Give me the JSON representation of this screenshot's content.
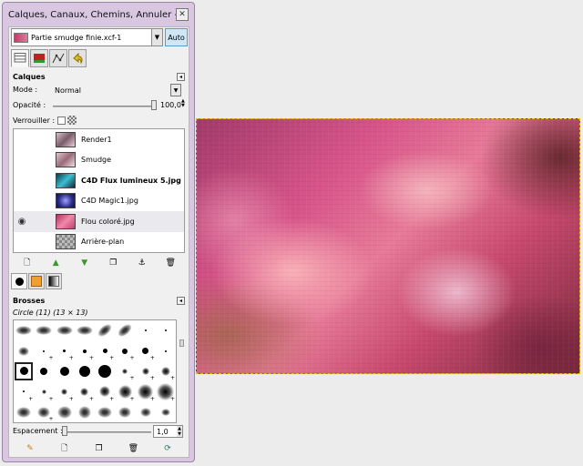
{
  "window": {
    "title": "Calques, Canaux, Chemins, Annuler - ..."
  },
  "image_selector": {
    "value": "Partie smudge finie.xcf-1",
    "auto_label": "Auto"
  },
  "layers_panel": {
    "title": "Calques",
    "mode_label": "Mode :",
    "mode_value": "Normal",
    "opacity_label": "Opacité :",
    "opacity_value": "100,0",
    "lock_label": "Verrouiller :",
    "layers": [
      {
        "name": "Render1",
        "bold": false,
        "visible": false,
        "thumb": "#b08a9a"
      },
      {
        "name": "Smudge",
        "bold": false,
        "visible": false,
        "thumb": "#c49aa4"
      },
      {
        "name": "C4D Flux lumineux 5.jpg",
        "bold": true,
        "visible": false,
        "thumb": "#2a7a8a"
      },
      {
        "name": "C4D Magic1.jpg",
        "bold": false,
        "visible": false,
        "thumb": "#3a3a9a"
      },
      {
        "name": "Flou coloré.jpg",
        "bold": false,
        "visible": true,
        "thumb": "#d84a78"
      },
      {
        "name": "Arrière-plan",
        "bold": false,
        "visible": false,
        "thumb": "#888888"
      }
    ]
  },
  "brushes_panel": {
    "title": "Brosses",
    "current": "Circle (11) (13 × 13)",
    "spacing_label": "Espacement :",
    "spacing_value": "1,0"
  }
}
